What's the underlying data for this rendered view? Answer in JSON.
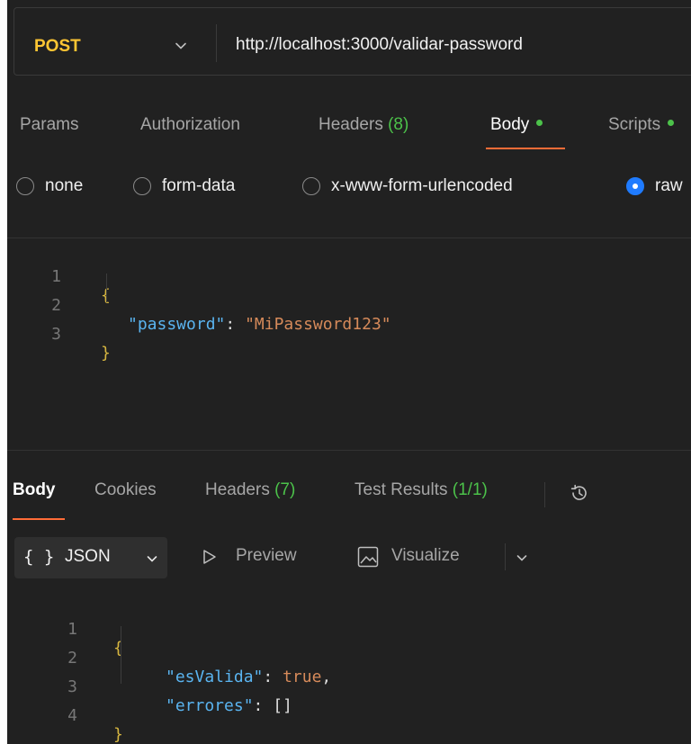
{
  "request": {
    "method": "POST",
    "url": "http://localhost:3000/validar-password"
  },
  "request_tabs": {
    "params": "Params",
    "authorization": "Authorization",
    "headers": "Headers",
    "headers_count": "(8)",
    "body": "Body",
    "scripts": "Scripts"
  },
  "body_types": {
    "none": "none",
    "form_data": "form-data",
    "urlencoded": "x-www-form-urlencoded",
    "raw": "raw",
    "selected": "raw"
  },
  "request_body": {
    "line_numbers": [
      "1",
      "2",
      "3"
    ],
    "open": "{",
    "key": "\"password\"",
    "colon": ": ",
    "value": "\"MiPassword123\"",
    "close": "}"
  },
  "response_tabs": {
    "body": "Body",
    "cookies": "Cookies",
    "headers": "Headers",
    "headers_count": "(7)",
    "test_results": "Test Results",
    "test_count": "(1/1)"
  },
  "response_toolbar": {
    "format_braces": "{ }",
    "format": "JSON",
    "preview": "Preview",
    "visualize": "Visualize"
  },
  "response_body": {
    "line_numbers": [
      "1",
      "2",
      "3",
      "4"
    ],
    "open": "{",
    "key1": "\"esValida\"",
    "value1": "true",
    "comma": ",",
    "key2": "\"errores\"",
    "value2": "[]",
    "colon": ": ",
    "close": "}"
  },
  "colors": {
    "method": "#ffc633",
    "accent": "#ff6c37",
    "success": "#4cc24a",
    "radio_selected": "#1f7bff",
    "background": "#212121"
  }
}
